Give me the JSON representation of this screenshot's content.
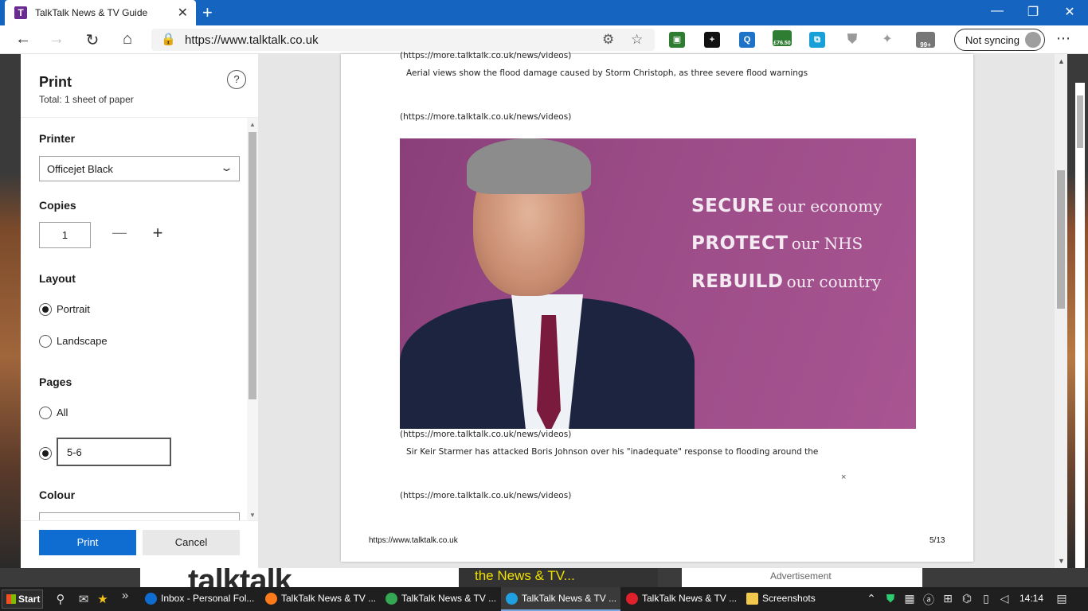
{
  "browser": {
    "tab_title": "TalkTalk News & TV Guide",
    "tab_favicon_letter": "T",
    "url": "https://www.talktalk.co.uk",
    "sync_label": "Not syncing",
    "extensions": {
      "stocks_badge": "£76.50",
      "notifications_badge": "99+",
      "q_label": "Q"
    }
  },
  "background_page": {
    "advertisement": "Advertisement",
    "logo_text": "talktalk",
    "yellow_text": "the News & TV..."
  },
  "print": {
    "title": "Print",
    "total": "Total: 1 sheet of paper",
    "help_label": "?",
    "printer_label": "Printer",
    "printer_value": "Officejet Black",
    "copies_label": "Copies",
    "copies_value": "1",
    "layout_label": "Layout",
    "layout_options": [
      "Portrait",
      "Landscape"
    ],
    "layout_selected": "Portrait",
    "pages_label": "Pages",
    "pages_all": "All",
    "pages_custom_value": "5-6",
    "colour_label": "Colour",
    "print_button": "Print",
    "cancel_button": "Cancel"
  },
  "preview": {
    "lines": {
      "link1": "(https://more.talktalk.co.uk/news/videos)",
      "caption1": "Aerial views show the flood damage caused by Storm Christoph, as three severe flood warnings",
      "link2": "(https://more.talktalk.co.uk/news/videos)",
      "link3": "(https://more.talktalk.co.uk/news/videos)",
      "caption2": "Sir Keir Starmer has attacked Boris Johnson over his \"inadequate\" response to flooding around the",
      "link4": "(https://more.talktalk.co.uk/news/videos)"
    },
    "image_slogans": [
      {
        "strong": "SECURE",
        "weak": "our economy"
      },
      {
        "strong": "PROTECT",
        "weak": "our NHS"
      },
      {
        "strong": "REBUILD",
        "weak": "our country"
      }
    ],
    "close_mark": "×",
    "footer_url": "https://www.talktalk.co.uk",
    "footer_page": "5/13"
  },
  "taskbar": {
    "start": "Start",
    "tasks": [
      {
        "label": "Inbox - Personal Fol...",
        "color": "#0f6cd1"
      },
      {
        "label": "TalkTalk News & TV ...",
        "color": "#ff7a1a"
      },
      {
        "label": "TalkTalk News & TV ...",
        "color": "#34a853"
      },
      {
        "label": "TalkTalk News & TV ...",
        "color": "#1fa0e0"
      },
      {
        "label": "TalkTalk News & TV ...",
        "color": "#e0202a"
      },
      {
        "label": "Screenshots",
        "color": "#f2c94c"
      }
    ],
    "time": "14:14"
  }
}
